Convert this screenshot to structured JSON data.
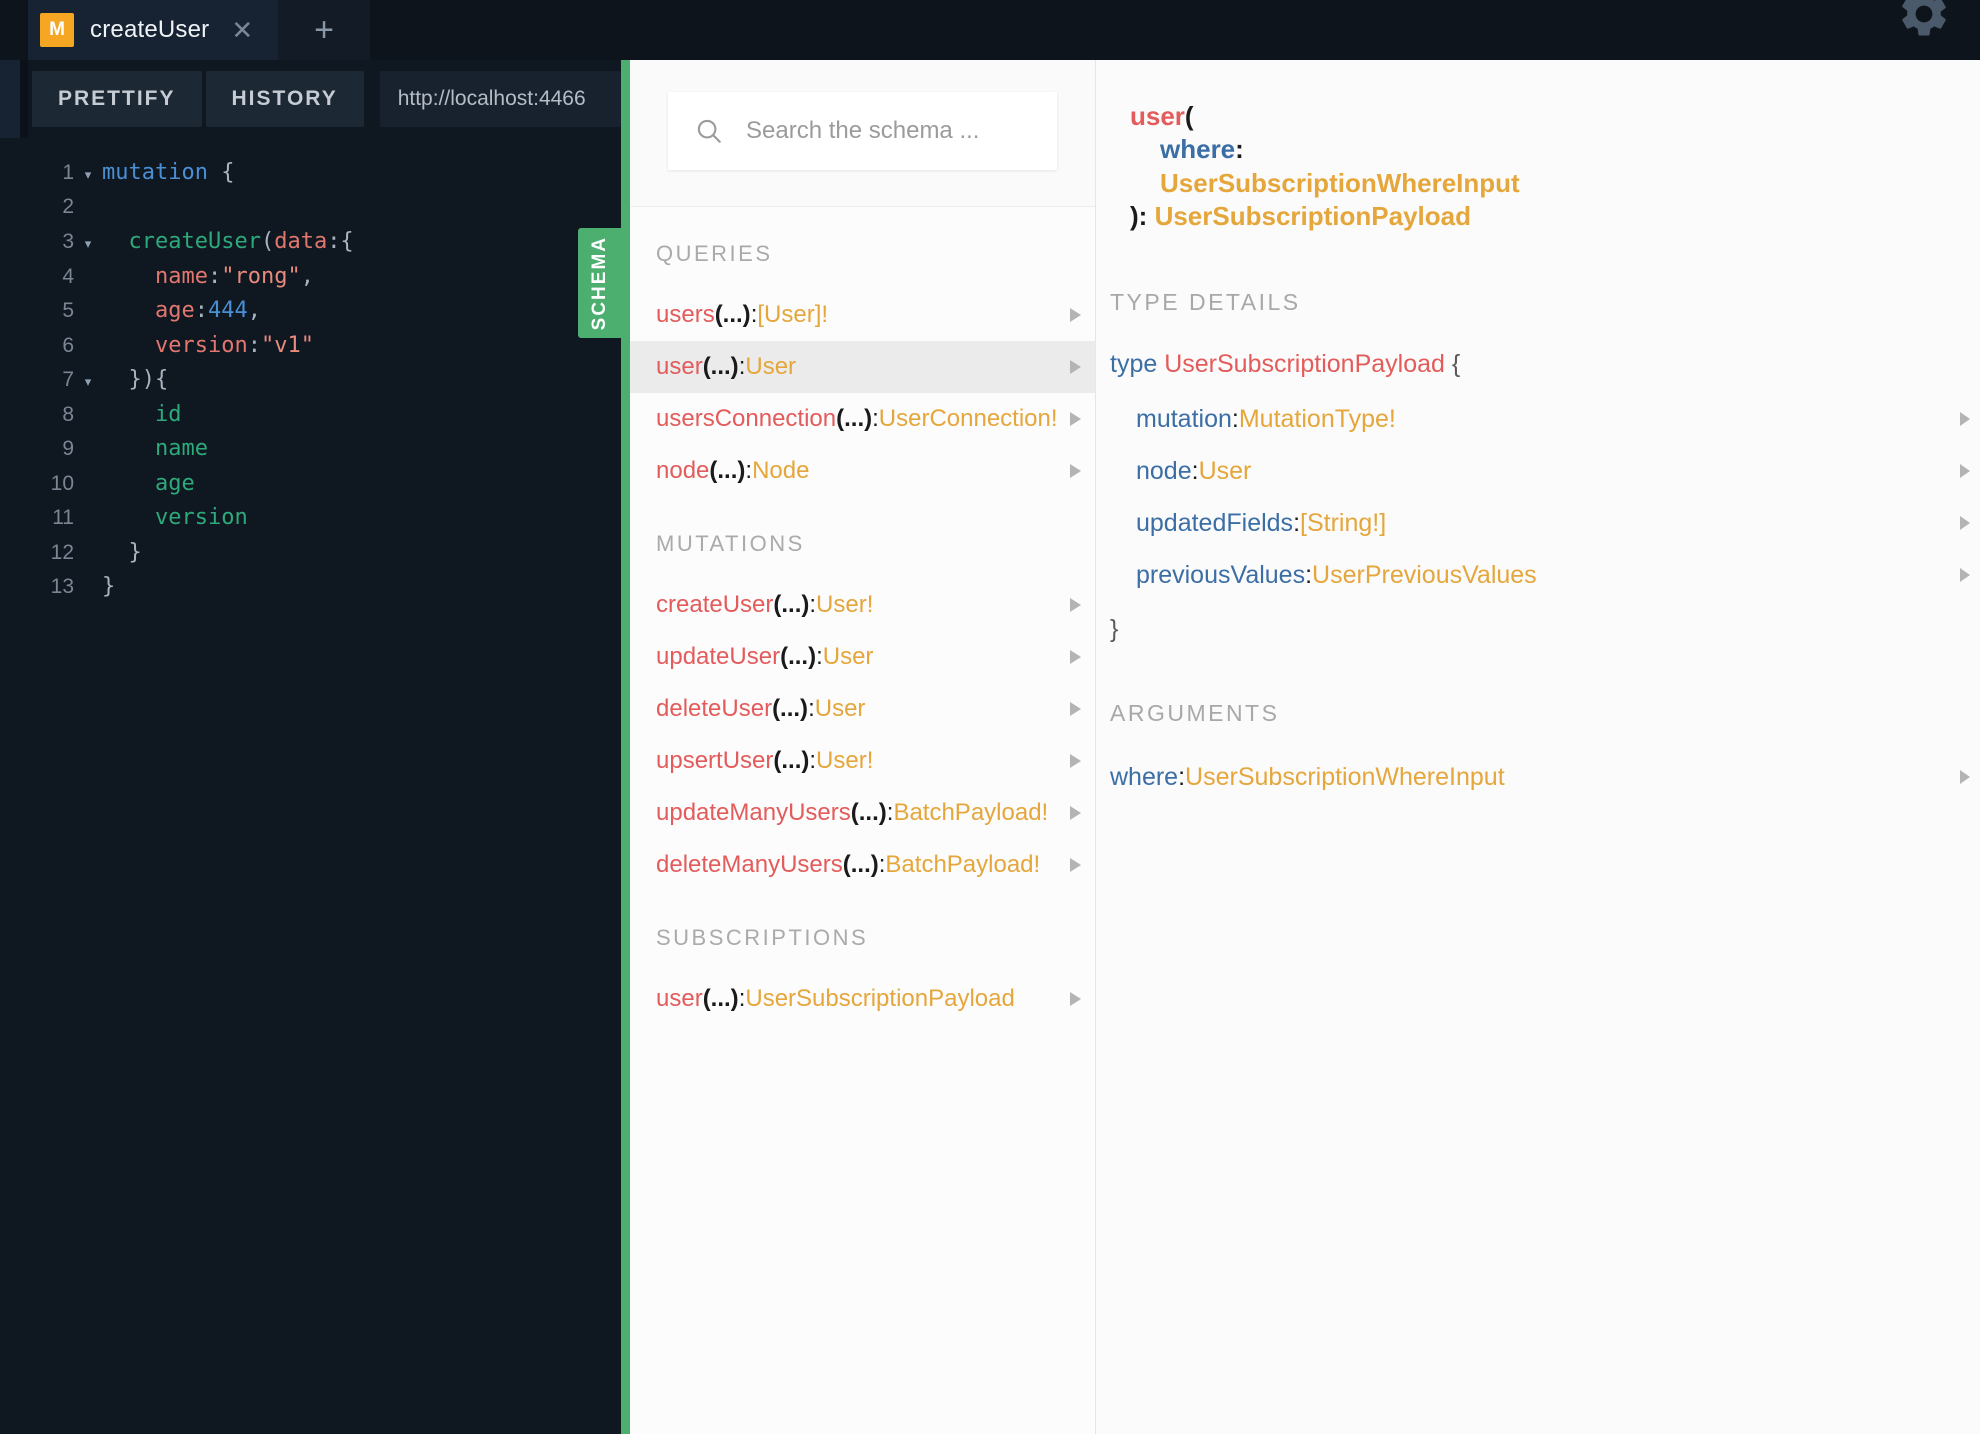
{
  "window": {
    "tab": {
      "badge": "M",
      "title": "createUser",
      "close_icon": "close-icon",
      "add_icon": "plus-icon"
    },
    "settings_icon": "gear-icon"
  },
  "toolbar": {
    "prettify_label": "PRETTIFY",
    "history_label": "HISTORY",
    "endpoint_url": "http://localhost:4466"
  },
  "editor": {
    "lines": [
      {
        "num": "1",
        "fold": "▾",
        "tokens": [
          {
            "t": "kw",
            "v": "mutation"
          },
          {
            "t": "plain",
            "v": " "
          },
          {
            "t": "punct",
            "v": "{"
          }
        ]
      },
      {
        "num": "2",
        "fold": "",
        "tokens": []
      },
      {
        "num": "3",
        "fold": "▾",
        "tokens": [
          {
            "t": "plain",
            "v": "  "
          },
          {
            "t": "field",
            "v": "createUser"
          },
          {
            "t": "punct",
            "v": "("
          },
          {
            "t": "arg",
            "v": "data"
          },
          {
            "t": "punct",
            "v": ":{"
          }
        ]
      },
      {
        "num": "4",
        "fold": "",
        "tokens": [
          {
            "t": "plain",
            "v": "    "
          },
          {
            "t": "arg",
            "v": "name"
          },
          {
            "t": "punct",
            "v": ":"
          },
          {
            "t": "str",
            "v": "\"rong\""
          },
          {
            "t": "punct",
            "v": ","
          }
        ]
      },
      {
        "num": "5",
        "fold": "",
        "tokens": [
          {
            "t": "plain",
            "v": "    "
          },
          {
            "t": "arg",
            "v": "age"
          },
          {
            "t": "punct",
            "v": ":"
          },
          {
            "t": "num",
            "v": "444"
          },
          {
            "t": "punct",
            "v": ","
          }
        ]
      },
      {
        "num": "6",
        "fold": "",
        "tokens": [
          {
            "t": "plain",
            "v": "    "
          },
          {
            "t": "arg",
            "v": "version"
          },
          {
            "t": "punct",
            "v": ":"
          },
          {
            "t": "str",
            "v": "\"v1\""
          }
        ]
      },
      {
        "num": "7",
        "fold": "▾",
        "tokens": [
          {
            "t": "plain",
            "v": "  "
          },
          {
            "t": "punct",
            "v": "}){"
          }
        ]
      },
      {
        "num": "8",
        "fold": "",
        "tokens": [
          {
            "t": "plain",
            "v": "    "
          },
          {
            "t": "field",
            "v": "id"
          }
        ]
      },
      {
        "num": "9",
        "fold": "",
        "tokens": [
          {
            "t": "plain",
            "v": "    "
          },
          {
            "t": "field",
            "v": "name"
          }
        ]
      },
      {
        "num": "10",
        "fold": "",
        "tokens": [
          {
            "t": "plain",
            "v": "    "
          },
          {
            "t": "field",
            "v": "age"
          }
        ]
      },
      {
        "num": "11",
        "fold": "",
        "tokens": [
          {
            "t": "plain",
            "v": "    "
          },
          {
            "t": "field",
            "v": "version"
          }
        ]
      },
      {
        "num": "12",
        "fold": "",
        "tokens": [
          {
            "t": "plain",
            "v": "  "
          },
          {
            "t": "punct",
            "v": "}"
          }
        ]
      },
      {
        "num": "13",
        "fold": "",
        "tokens": [
          {
            "t": "punct",
            "v": "}"
          }
        ]
      }
    ]
  },
  "schema_tab": {
    "label": "SCHEMA"
  },
  "schema": {
    "search_placeholder": "Search the schema ...",
    "search_icon": "search-icon",
    "sections": [
      {
        "heading": "QUERIES",
        "rows": [
          {
            "field": "users",
            "args": "(...)",
            "colon": ": ",
            "type": "[User]!",
            "active": false
          },
          {
            "field": "user",
            "args": "(...)",
            "colon": ": ",
            "type": "User",
            "active": true
          },
          {
            "field": "usersConnection",
            "args": "(...)",
            "colon": ": ",
            "type": "UserConnection!",
            "active": false
          },
          {
            "field": "node",
            "args": "(...)",
            "colon": ": ",
            "type": "Node",
            "active": false
          }
        ]
      },
      {
        "heading": "MUTATIONS",
        "rows": [
          {
            "field": "createUser",
            "args": "(...)",
            "colon": ": ",
            "type": "User!",
            "active": false
          },
          {
            "field": "updateUser",
            "args": "(...)",
            "colon": ": ",
            "type": "User",
            "active": false
          },
          {
            "field": "deleteUser",
            "args": "(...)",
            "colon": ": ",
            "type": "User",
            "active": false
          },
          {
            "field": "upsertUser",
            "args": "(...)",
            "colon": ": ",
            "type": "User!",
            "active": false
          },
          {
            "field": "updateManyUsers",
            "args": "(...)",
            "colon": ": ",
            "type": "BatchPayload!",
            "active": false
          },
          {
            "field": "deleteManyUsers",
            "args": "(...)",
            "colon": ": ",
            "type": "BatchPayload!",
            "active": false
          }
        ]
      },
      {
        "heading": "SUBSCRIPTIONS",
        "rows": [
          {
            "field": "user",
            "args": "(...)",
            "colon": ": ",
            "type": "UserSubscriptionPayload",
            "active": false
          }
        ]
      }
    ]
  },
  "detail": {
    "signature": {
      "name": "user",
      "open_paren": "(",
      "arg_name": "where",
      "arg_colon": ":",
      "arg_type": "UserSubscriptionWhereInput",
      "close_paren": ")",
      "return_colon": ": ",
      "return_type": "UserSubscriptionPayload"
    },
    "type_details": {
      "heading": "TYPE DETAILS",
      "keyword": "type",
      "type_name": "UserSubscriptionPayload",
      "open_brace": "{",
      "close_brace": "}",
      "fields": [
        {
          "name": "mutation",
          "colon": ": ",
          "type": "MutationType!"
        },
        {
          "name": "node",
          "colon": ": ",
          "type": "User"
        },
        {
          "name": "updatedFields",
          "colon": ": ",
          "type": "[String!]"
        },
        {
          "name": "previousValues",
          "colon": ": ",
          "type": "UserPreviousValues"
        }
      ]
    },
    "arguments": {
      "heading": "ARGUMENTS",
      "items": [
        {
          "name": "where",
          "colon": ": ",
          "type": "UserSubscriptionWhereInput"
        }
      ]
    }
  },
  "colors": {
    "accent_green": "#4caf70",
    "badge_orange": "#f5a623",
    "field_red": "#e35b5b",
    "type_orange": "#e5a63b",
    "arg_blue": "#3b6ea5",
    "editor_bg": "#0f1721"
  }
}
